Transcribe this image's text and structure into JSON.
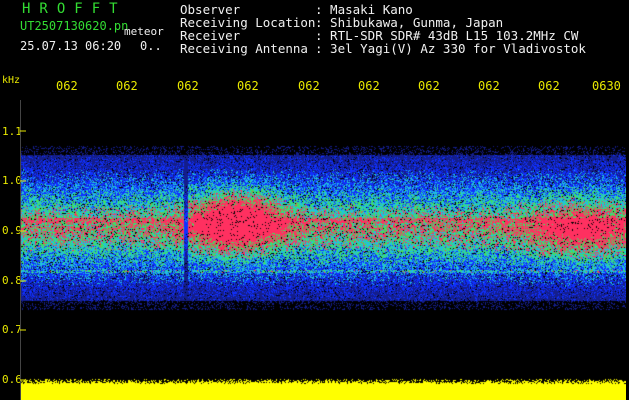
{
  "header": {
    "app_title": "HROFFT",
    "file_name": "UT2507130620.pn",
    "meteor_label": "meteor",
    "datetime": "25.07.13 06:20",
    "count": "0.."
  },
  "info": [
    {
      "label": "Observer",
      "value": ": Masaki Kano"
    },
    {
      "label": "Receiving Location",
      "value": ": Shibukawa, Gunma, Japan"
    },
    {
      "label": "Receiver",
      "value": ": RTL-SDR SDR# 43dB L15 103.2MHz CW"
    },
    {
      "label": "Receiving Antenna",
      "value": ": 3el Yagi(V) Az 330 for Vladivostok"
    }
  ],
  "axis": {
    "y_unit": "kHz",
    "y_ticks": [
      "1.1",
      "1.0",
      "0.9",
      "0.8",
      "0.7",
      "0.6"
    ],
    "x_ticks": [
      "062",
      "062",
      "062",
      "062",
      "062",
      "062",
      "062",
      "062",
      "062",
      "0630"
    ]
  },
  "colors": {
    "title_green": "#33dd33",
    "text_white": "#f0f0f0",
    "tick_yellow": "#e8e800",
    "spectrum_blue": "#1030ff",
    "spectrum_cyan": "#20c0e0",
    "spectrum_green": "#40e060",
    "spectrum_red": "#ff3060",
    "baseline_yellow": "#ffff00"
  }
}
